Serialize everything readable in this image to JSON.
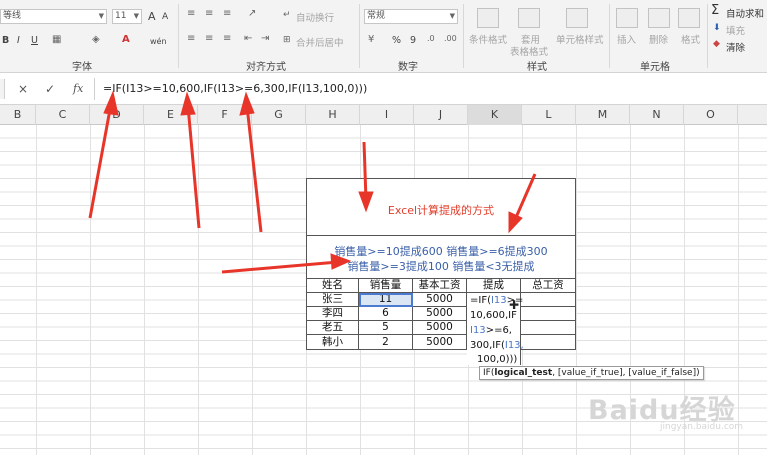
{
  "ribbon": {
    "font_name": "等线",
    "font_size": "11",
    "font_buttons": [
      "B",
      "I",
      "U"
    ],
    "grow_font": "A",
    "shrink_font": "A",
    "wen_button": "wén",
    "wrap_text": "自动换行",
    "merge_center": "合并后居中",
    "number_format": "常规",
    "percent": "%",
    "comma": "9",
    "cond_format": "条件格式",
    "table_format": "套用",
    "table_format2": "表格格式",
    "cell_style": "单元格样式",
    "insert": "插入",
    "delete": "删除",
    "format": "格式",
    "autosum_sym": "Σ",
    "autosum": "自动求和",
    "fill": "填充",
    "clear": "清除",
    "groups": [
      "字体",
      "对齐方式",
      "数字",
      "样式",
      "单元格"
    ]
  },
  "formula_bar": {
    "cancel": "×",
    "confirm": "✓",
    "fx": "fx",
    "formula": "=IF(I13>=10,600,IF(I13>=6,300,IF(I13,100,0)))"
  },
  "columns": [
    "B",
    "C",
    "D",
    "E",
    "F",
    "G",
    "H",
    "I",
    "J",
    "K",
    "L",
    "M",
    "N",
    "O"
  ],
  "sheet": {
    "title": "Excel计算提成的方式",
    "rule_line1": "销售量>=10提成600  销售量>=6提成300",
    "rule_line2": "销售量>=3提成100  销售量<3无提成",
    "headers": [
      "姓名",
      "销售量",
      "基本工资",
      "提成",
      "总工资"
    ],
    "rows": [
      {
        "name": "张三",
        "sales": "11",
        "base": "5000"
      },
      {
        "name": "李四",
        "sales": "6",
        "base": "5000"
      },
      {
        "name": "老五",
        "sales": "5",
        "base": "5000"
      },
      {
        "name": "韩小",
        "sales": "2",
        "base": "5000"
      }
    ],
    "editing_lines": [
      {
        "pre": "=IF(",
        "ref": "I13",
        "post": ">="
      },
      {
        "pre": "10,600,IF",
        "ref": "",
        "post": ""
      },
      {
        "pre": "",
        "ref": "I13",
        "post": ">=6,"
      },
      {
        "pre": "300,IF(",
        "ref": "I13,",
        "post": ""
      },
      {
        "pre": "100,0)))",
        "ref": "",
        "post": ""
      }
    ],
    "tooltip": {
      "pre": "IF(",
      "bold": "logical_test",
      "post": ", [value_if_true], [value_if_false])"
    }
  },
  "watermark": {
    "logo": "Baidu经验",
    "url": "jingyan.baidu.com"
  },
  "colors": {
    "arrow": "#e8352a",
    "title_red": "#e03c2a",
    "rule_blue": "#3a5fa8",
    "ref_blue": "#4b77c8"
  }
}
